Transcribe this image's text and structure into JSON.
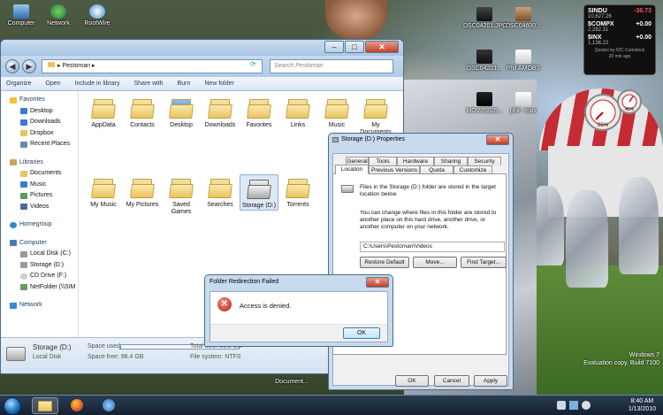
{
  "desktop": {
    "icons": [
      {
        "label": "Computer"
      },
      {
        "label": "Network"
      },
      {
        "label": "RootWire"
      },
      {
        "label": "DSC04201.JPG"
      },
      {
        "label": "DSC04600..."
      },
      {
        "label": "DSC04201..."
      },
      {
        "label": "Phil AMOBS"
      },
      {
        "label": "MOV05826..."
      },
      {
        "label": "phil - max"
      },
      {
        "label": "Document..."
      }
    ]
  },
  "stocks": {
    "rows": [
      {
        "symbol": "SINDU",
        "value": "10,627.26",
        "change": "-36.73"
      },
      {
        "symbol": "$COMPX",
        "value": "2,282.31",
        "change": "+0.00"
      },
      {
        "symbol": "$INX",
        "value": "1,136.22",
        "change": "+0.00"
      }
    ],
    "source": "Quotes by IDC Comstock",
    "age": "20 min ago"
  },
  "cpu_meter": {
    "cpu_label": "05%",
    "ram_label": "45%",
    "cpu_value": 5,
    "ram_value": 45
  },
  "explorer": {
    "address_root": "Pestoman",
    "search_placeholder": "Search Pestoman",
    "toolbar": [
      "Organize",
      "Open",
      "Include in library",
      "Share with",
      "Burn",
      "New folder"
    ],
    "nav": {
      "favorites_label": "Favorites",
      "favorites": [
        "Desktop",
        "Downloads",
        "Dropbox",
        "Recent Places"
      ],
      "libraries_label": "Libraries",
      "libraries": [
        "Documents",
        "Music",
        "Pictures",
        "Videos"
      ],
      "homegroup_label": "Homegroup",
      "computer_label": "Computer",
      "computer": [
        "Local Disk (C:)",
        "Storage (D:)",
        "CD Drive (F:)",
        "NetFolder (\\\\SIM"
      ],
      "network_label": "Network"
    },
    "folders": [
      {
        "label": "AppData"
      },
      {
        "label": "Contacts"
      },
      {
        "label": "Desktop"
      },
      {
        "label": "Downloads"
      },
      {
        "label": "Favorites"
      },
      {
        "label": "Links"
      },
      {
        "label": "Music"
      },
      {
        "label": "My Documents"
      },
      {
        "label": "My Music"
      },
      {
        "label": "My Pictures"
      },
      {
        "label": "Saved Games"
      },
      {
        "label": "Searches"
      },
      {
        "label": "Storage (D:)"
      },
      {
        "label": "Torrents"
      }
    ],
    "details": {
      "name": "Storage (D:)",
      "type": "Local Disk",
      "space_used_label": "Space used:",
      "space_used_fraction": 0.01,
      "space_free": "Space free: 98.4 GB",
      "total_size": "Total size: 99.2 GB",
      "file_system": "File system: NTFS"
    }
  },
  "properties": {
    "title": "Storage (D:) Properties",
    "tabs_row1": [
      "General",
      "Tools",
      "Hardware",
      "Sharing",
      "Security"
    ],
    "tabs_row2": [
      "Location",
      "Previous Versions",
      "Quota",
      "Customize"
    ],
    "active_tab": "Location",
    "intro": "Files in the Storage (D:) folder are stored in the target location below.",
    "body": "You can change where files in this folder are stored to another place on this hard drive, another drive, or another computer on your network.",
    "path_value": "C:\\Users\\Pestoman\\Videos",
    "buttons": {
      "restore": "Restore Default",
      "move": "Move...",
      "find": "Find Target...",
      "ok": "OK",
      "cancel": "Cancel",
      "apply": "Apply"
    }
  },
  "error_dialog": {
    "title": "Folder Redirection Failed",
    "message": "Access is denied.",
    "ok": "OK"
  },
  "taskbar": {
    "time": "8:40 AM",
    "date": "1/13/2010",
    "os_line1": "Windows 7",
    "os_line2": "Evaluation copy. Build 7100"
  },
  "colors": {
    "accent": "#1e395b",
    "window_frame": "#bcd3ea",
    "error_red": "#c41a0d",
    "stock_down": "#ff5050"
  }
}
